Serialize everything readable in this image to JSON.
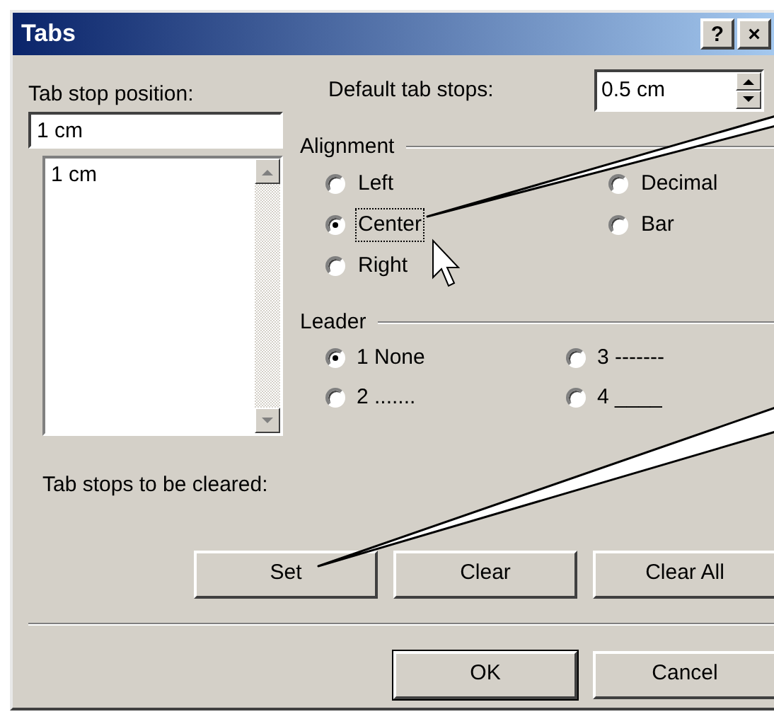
{
  "window": {
    "title": "Tabs",
    "title_buttons": [
      "?",
      "×"
    ]
  },
  "tab_stop_position": {
    "label": "Tab stop position:",
    "value": "1 cm",
    "list": [
      "1 cm"
    ]
  },
  "default_tab_stops": {
    "label": "Default tab stops:",
    "value": "0.5 cm"
  },
  "alignment": {
    "label": "Alignment",
    "options": [
      {
        "label": "Left",
        "selected": false,
        "focused": false
      },
      {
        "label": "Center",
        "selected": true,
        "focused": true
      },
      {
        "label": "Right",
        "selected": false,
        "focused": false
      },
      {
        "label": "Decimal",
        "selected": false,
        "focused": false
      },
      {
        "label": "Bar",
        "selected": false,
        "focused": false
      }
    ]
  },
  "leader": {
    "label": "Leader",
    "options": [
      {
        "label": "1 None",
        "selected": true
      },
      {
        "label": "2 .......",
        "selected": false
      },
      {
        "label": "3 -------",
        "selected": false
      },
      {
        "label": "4 ____",
        "selected": false
      }
    ]
  },
  "clear_label": "Tab stops to be cleared:",
  "buttons": [
    {
      "label": "Set",
      "default": false
    },
    {
      "label": "Clear",
      "default": false
    },
    {
      "label": "Clear All",
      "default": false
    }
  ],
  "footer_buttons": [
    {
      "label": "OK",
      "default": true
    },
    {
      "label": "Cancel",
      "default": false
    }
  ]
}
